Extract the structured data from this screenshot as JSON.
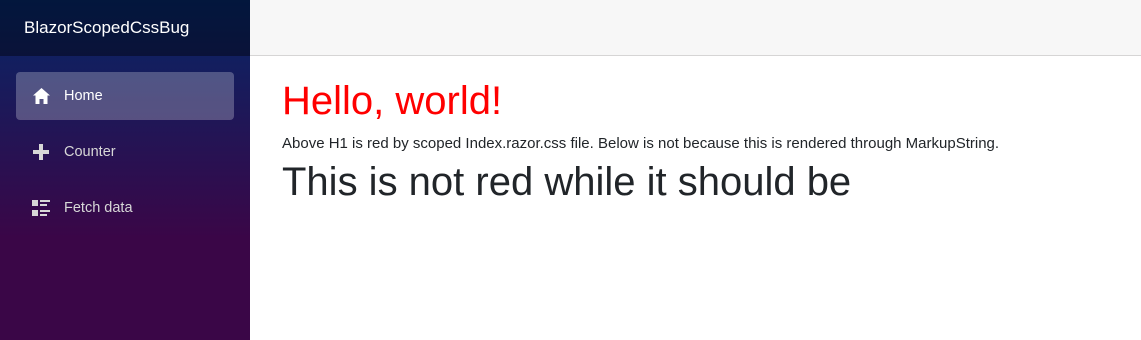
{
  "brand": {
    "title": "BlazorScopedCssBug"
  },
  "sidebar": {
    "items": [
      {
        "label": "Home",
        "icon": "home-icon",
        "active": true
      },
      {
        "label": "Counter",
        "icon": "plus-icon",
        "active": false
      },
      {
        "label": "Fetch data",
        "icon": "list-rich-icon",
        "active": false
      }
    ]
  },
  "main": {
    "heading_red": "Hello, world!",
    "paragraph": "Above H1 is red by scoped Index.razor.css file. Below is not because this is rendered through MarkupString.",
    "heading_black": "This is not red while it should be"
  },
  "colors": {
    "heading_red": "#ff0000",
    "sidebar_gradient_top": "#052767",
    "sidebar_gradient_bottom": "#3a0647",
    "top_row_bg": "#f7f7f7"
  }
}
